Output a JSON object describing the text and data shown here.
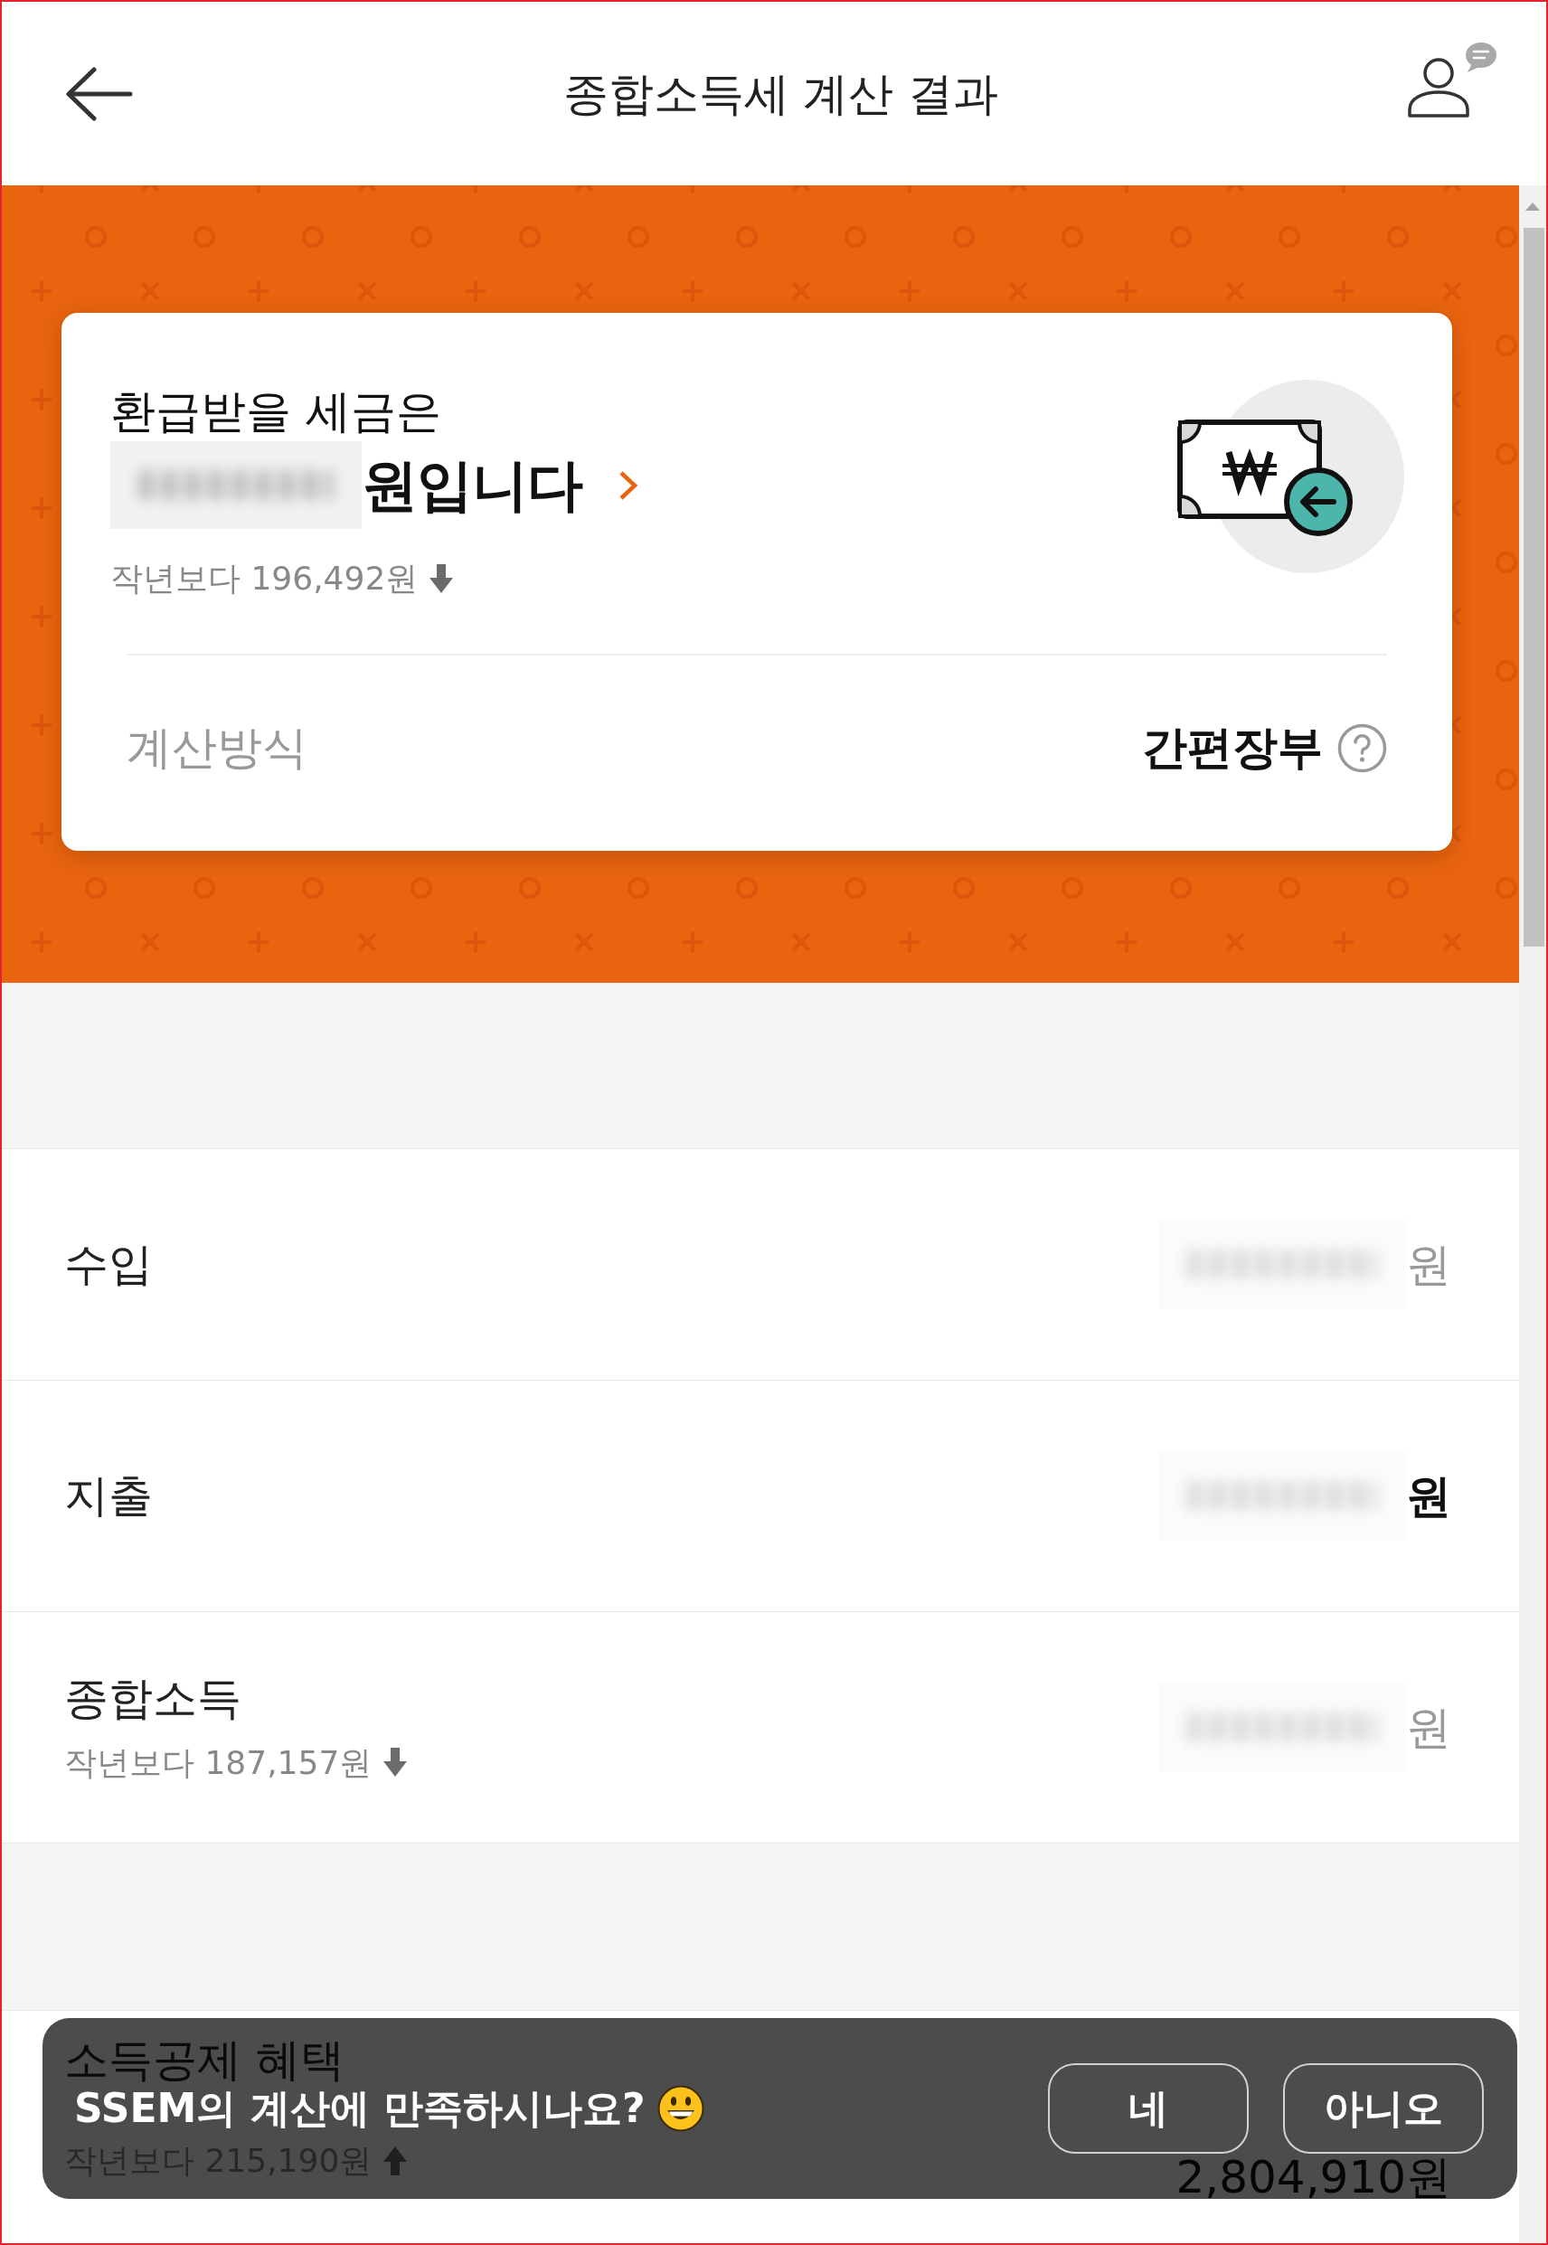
{
  "header": {
    "title": "종합소득세 계산 결과"
  },
  "refund_card": {
    "heading": "환급받을 세금은",
    "amount": {
      "redacted": true,
      "suffix": "원입니다"
    },
    "comparison": {
      "text": "작년보다 196,492원",
      "kind": "down"
    },
    "method": {
      "label": "계산방식",
      "value": "간편장부"
    }
  },
  "summary_rows": [
    {
      "label": "수입",
      "redacted": true,
      "unit": "원",
      "emphasized": false
    },
    {
      "label": "지출",
      "redacted": true,
      "unit": "원",
      "emphasized": true
    },
    {
      "label": "종합소득",
      "comparison": {
        "text": "작년보다 187,157원",
        "kind": "down"
      },
      "redacted": true,
      "unit": "원",
      "emphasized": false
    }
  ],
  "deduction_row": {
    "label": "소득공제 혜택",
    "comparison": {
      "text": "작년보다 215,190원",
      "kind": "up"
    },
    "value": "2,804,910원"
  },
  "feedback_toast": {
    "question": "SSEM의 계산에 만족하시나요?",
    "buttons": [
      "네",
      "아니오"
    ]
  }
}
